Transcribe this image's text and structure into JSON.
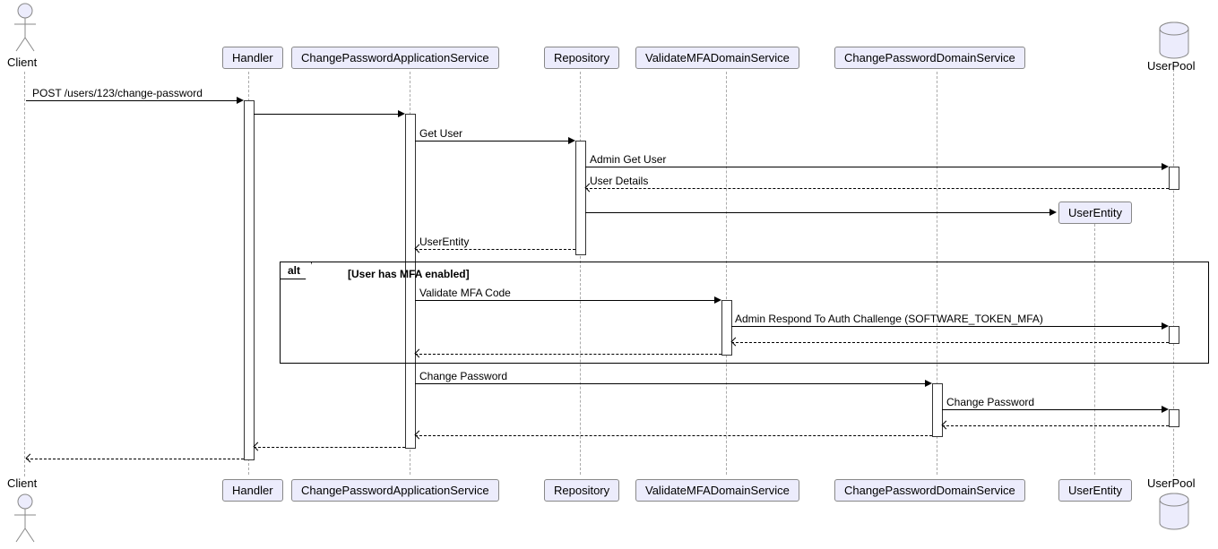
{
  "participants": {
    "client": "Client",
    "handler": "Handler",
    "appService": "ChangePasswordApplicationService",
    "repository": "Repository",
    "validateMfa": "ValidateMFADomainService",
    "changePwdDomain": "ChangePasswordDomainService",
    "userEntity": "UserEntity",
    "userPool": "UserPool"
  },
  "messages": {
    "m1": "POST /users/123/change-password",
    "m2": "Get User",
    "m3": "Admin Get User",
    "m4": "User Details",
    "m5": "UserEntity",
    "m6": "Validate MFA Code",
    "m7": "Admin Respond To Auth Challenge (SOFTWARE_TOKEN_MFA)",
    "m8": "Change Password",
    "m9": "Change Password"
  },
  "alt": {
    "tag": "alt",
    "condition": "[User has MFA enabled]"
  },
  "chart_data": {
    "type": "sequence_diagram",
    "participants": [
      {
        "id": "Client",
        "kind": "actor"
      },
      {
        "id": "Handler",
        "kind": "participant"
      },
      {
        "id": "ChangePasswordApplicationService",
        "kind": "participant"
      },
      {
        "id": "Repository",
        "kind": "participant"
      },
      {
        "id": "ValidateMFADomainService",
        "kind": "participant"
      },
      {
        "id": "ChangePasswordDomainService",
        "kind": "participant"
      },
      {
        "id": "UserEntity",
        "kind": "participant"
      },
      {
        "id": "UserPool",
        "kind": "database"
      }
    ],
    "interactions": [
      {
        "from": "Client",
        "to": "Handler",
        "label": "POST /users/123/change-password",
        "type": "sync"
      },
      {
        "from": "Handler",
        "to": "ChangePasswordApplicationService",
        "label": "",
        "type": "sync"
      },
      {
        "from": "ChangePasswordApplicationService",
        "to": "Repository",
        "label": "Get User",
        "type": "sync"
      },
      {
        "from": "Repository",
        "to": "UserPool",
        "label": "Admin Get User",
        "type": "sync"
      },
      {
        "from": "UserPool",
        "to": "Repository",
        "label": "User Details",
        "type": "return"
      },
      {
        "from": "Repository",
        "to": "UserEntity",
        "label": "",
        "type": "create"
      },
      {
        "from": "Repository",
        "to": "ChangePasswordApplicationService",
        "label": "UserEntity",
        "type": "return"
      },
      {
        "fragment": "alt",
        "condition": "User has MFA enabled",
        "steps": [
          {
            "from": "ChangePasswordApplicationService",
            "to": "ValidateMFADomainService",
            "label": "Validate MFA Code",
            "type": "sync"
          },
          {
            "from": "ValidateMFADomainService",
            "to": "UserPool",
            "label": "Admin Respond To Auth Challenge (SOFTWARE_TOKEN_MFA)",
            "type": "sync"
          },
          {
            "from": "UserPool",
            "to": "ValidateMFADomainService",
            "label": "",
            "type": "return"
          },
          {
            "from": "ValidateMFADomainService",
            "to": "ChangePasswordApplicationService",
            "label": "",
            "type": "return"
          }
        ]
      },
      {
        "from": "ChangePasswordApplicationService",
        "to": "ChangePasswordDomainService",
        "label": "Change Password",
        "type": "sync"
      },
      {
        "from": "ChangePasswordDomainService",
        "to": "UserPool",
        "label": "Change Password",
        "type": "sync"
      },
      {
        "from": "UserPool",
        "to": "ChangePasswordDomainService",
        "label": "",
        "type": "return"
      },
      {
        "from": "ChangePasswordDomainService",
        "to": "ChangePasswordApplicationService",
        "label": "",
        "type": "return"
      },
      {
        "from": "ChangePasswordApplicationService",
        "to": "Handler",
        "label": "",
        "type": "return"
      },
      {
        "from": "Handler",
        "to": "Client",
        "label": "",
        "type": "return"
      }
    ]
  }
}
